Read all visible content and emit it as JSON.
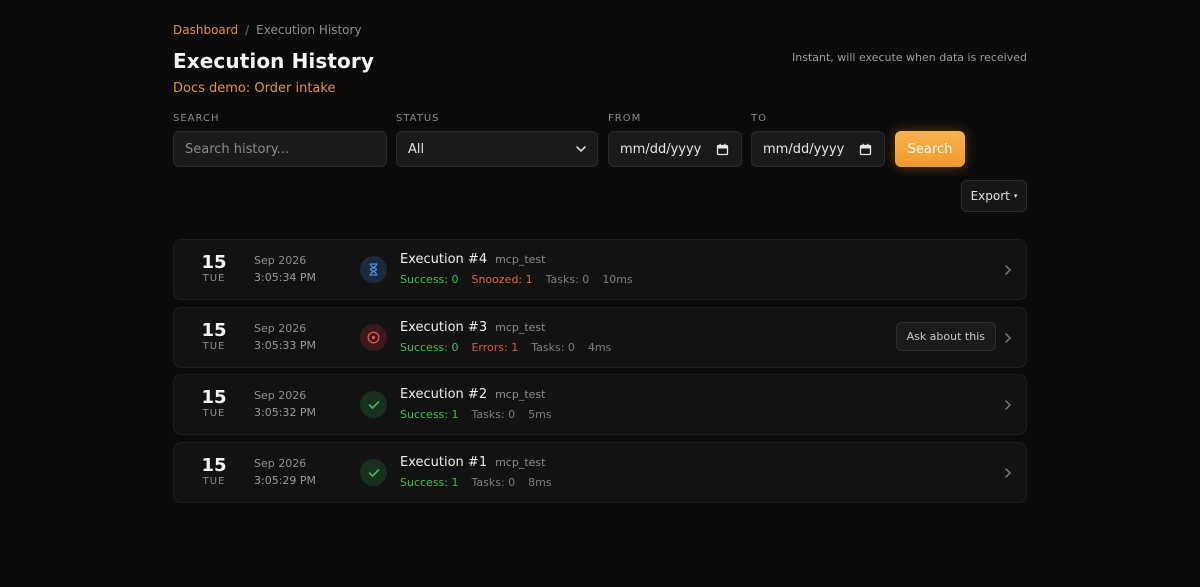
{
  "breadcrumb": {
    "root": "Dashboard",
    "separator": "/",
    "current": "Execution History"
  },
  "page": {
    "title": "Execution History",
    "subtitle": "Docs demo: Order intake",
    "trigger_note": "Instant, will execute when data is received"
  },
  "filters": {
    "search_label": "SEARCH",
    "search_placeholder": "Search history...",
    "status_label": "STATUS",
    "status_value": "All",
    "from_label": "FROM",
    "from_value": "mm/dd/yyyy",
    "to_label": "TO",
    "to_value": "mm/dd/yyyy",
    "search_button": "Search"
  },
  "export": {
    "label": "Export",
    "caret": "▾"
  },
  "executions": [
    {
      "day": "15",
      "dow": "TUE",
      "month": "Sep 2026",
      "time": "3:05:34 PM",
      "status": "snoozed",
      "status_icon": "hourglass-icon",
      "name": "Execution #4",
      "tag": "mcp_test",
      "stat1": "Success: 0",
      "stat2": "Snoozed: 1",
      "stat3": "Tasks: 0",
      "stat4": "10ms"
    },
    {
      "day": "15",
      "dow": "TUE",
      "month": "Sep 2026",
      "time": "3:05:33 PM",
      "status": "error",
      "status_icon": "error-circle-icon",
      "name": "Execution #3",
      "tag": "mcp_test",
      "stat1": "Success: 0",
      "stat2": "Errors: 1",
      "stat3": "Tasks: 0",
      "stat4": "4ms",
      "ask": "Ask about this"
    },
    {
      "day": "15",
      "dow": "TUE",
      "month": "Sep 2026",
      "time": "3:05:32 PM",
      "status": "success",
      "status_icon": "check-icon",
      "name": "Execution #2",
      "tag": "mcp_test",
      "stat1": "Success: 1",
      "stat2": "Tasks: 0",
      "stat3": "5ms"
    },
    {
      "day": "15",
      "dow": "TUE",
      "month": "Sep 2026",
      "time": "3:05:29 PM",
      "status": "success",
      "status_icon": "check-icon",
      "name": "Execution #1",
      "tag": "mcp_test",
      "stat1": "Success: 1",
      "stat2": "Tasks: 0",
      "stat3": "8ms"
    }
  ],
  "colors": {
    "accent": "#F09A2C",
    "success": "#3FBF55",
    "warning": "#E0673D",
    "error": "#E0553F",
    "snoozed_icon": "#4A90D9"
  }
}
